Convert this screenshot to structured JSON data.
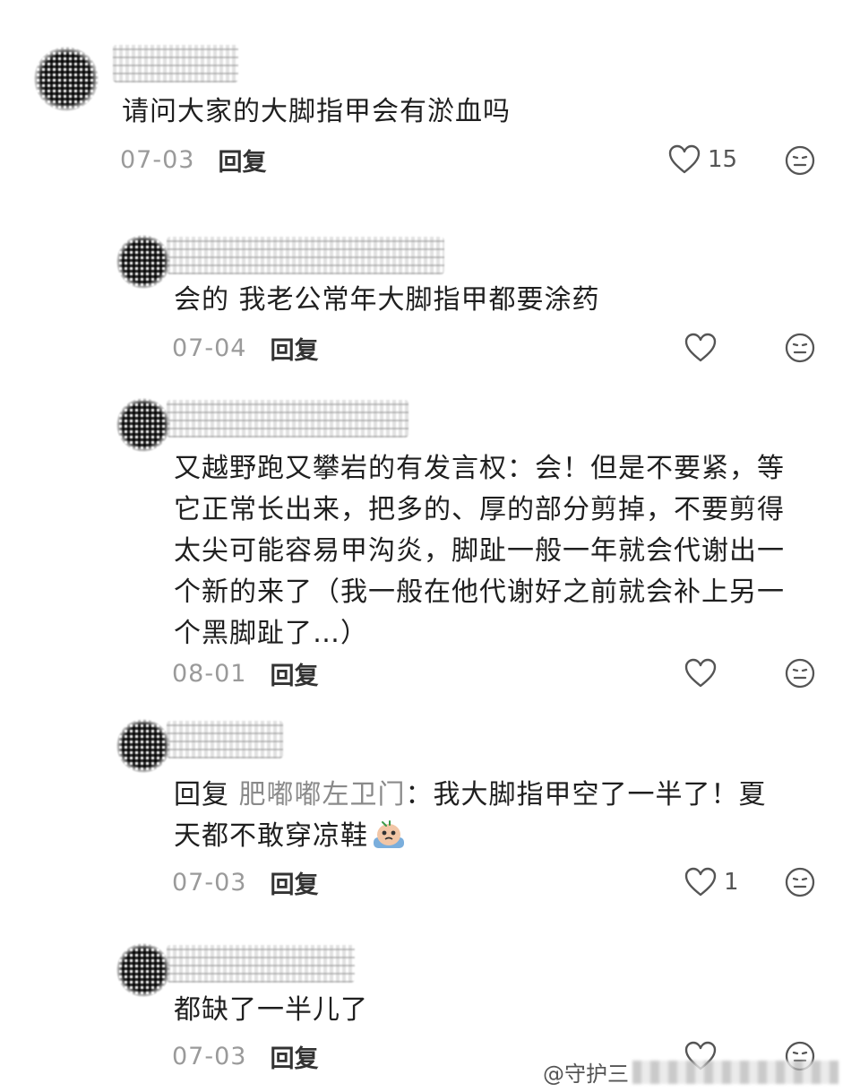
{
  "comments": [
    {
      "text": "请问大家的大脚指甲会有淤血吗",
      "date": "07-03",
      "reply_label": "回复",
      "likes": "15"
    },
    {
      "text": "会的 我老公常年大脚指甲都要涂药",
      "date": "07-04",
      "reply_label": "回复"
    },
    {
      "lines": [
        "又越野跑又攀岩的有发言权：会！但是不要紧，等",
        "它正常长出来，把多的、厚的部分剪掉，不要剪得",
        "太尖可能容易甲沟炎，脚趾一般一年就会代谢出一",
        "个新的来了（我一般在他代谢好之前就会补上另一",
        "个黑脚趾了…）"
      ],
      "date": "08-01",
      "reply_label": "回复"
    },
    {
      "reply_prefix": "回复",
      "reply_target": "肥嘟嘟左卫门",
      "line1_rest": "：我大脚指甲空了一半了！夏",
      "line2": "天都不敢穿凉鞋",
      "date": "07-03",
      "reply_label": "回复",
      "likes": "1"
    },
    {
      "text": "都缺了一半儿了",
      "date": "07-03",
      "reply_label": "回复"
    }
  ],
  "watermark": {
    "text": "@守护三"
  },
  "icons": {
    "heart": "heart-outline-icon",
    "emoji": "neutral-face-icon",
    "sticker": "crying-sticker-icon"
  },
  "colors": {
    "text": "#1f1f1f",
    "muted": "#9a9a9a",
    "icon": "#555555"
  }
}
